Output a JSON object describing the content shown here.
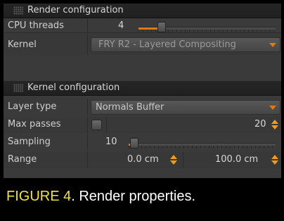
{
  "render_section": {
    "title": "Render configuration",
    "cpu_threads": {
      "label": "CPU threads",
      "value": "4",
      "slider_fraction": 0.15
    },
    "kernel": {
      "label": "Kernel",
      "value": "FRY R2 - Layered Compositing"
    }
  },
  "kernel_section": {
    "title": "Kernel configuration",
    "layer_type": {
      "label": "Layer type",
      "value": "Normals Buffer"
    },
    "max_passes": {
      "label": "Max passes",
      "value": "20"
    },
    "sampling": {
      "label": "Sampling",
      "value": "10",
      "slider_fraction": 0.02
    },
    "range": {
      "label": "Range",
      "min": "0.0 cm",
      "max": "100.0 cm"
    }
  },
  "caption": {
    "figure": "FIGURE 4",
    "text": ". Render properties."
  },
  "colors": {
    "accent": "#e07b12",
    "caption_figure": "#f3e23a",
    "panel": "#3a3a3a"
  },
  "icons": [
    "grip-icon",
    "dropdown-arrow-icon",
    "stepper-icon"
  ]
}
